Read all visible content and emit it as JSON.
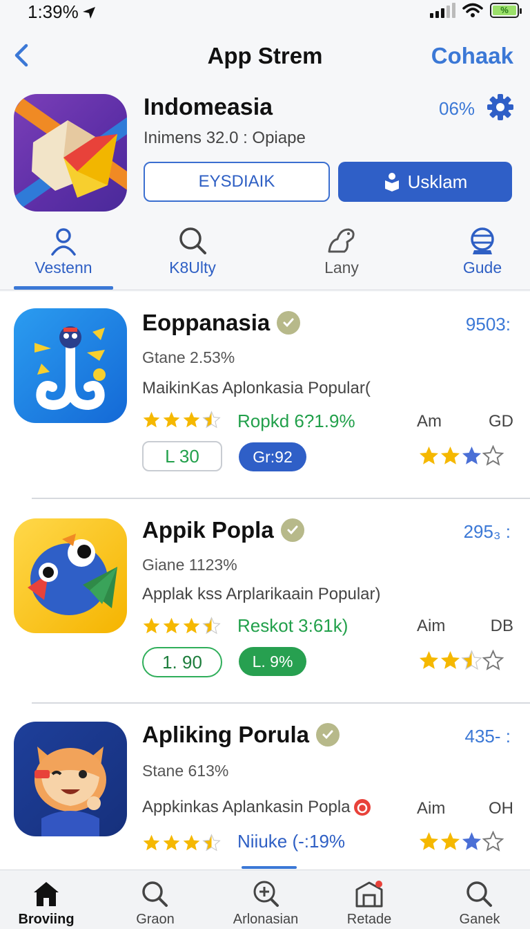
{
  "status_bar": {
    "time": "1:39%"
  },
  "nav": {
    "title": "App Strem",
    "action": "Cohaak"
  },
  "header_app": {
    "name": "Indomeasia",
    "subtitle": "Inimens 32.0 : Opiape",
    "percent": "06%",
    "outline_button": "EYSDIAIK",
    "solid_button": "Usklam"
  },
  "tabs": [
    {
      "label": "Vestenn",
      "icon": "person-icon"
    },
    {
      "label": "K8Ulty",
      "icon": "search-icon"
    },
    {
      "label": "Lany",
      "icon": "ghost-icon"
    },
    {
      "label": "Gude",
      "icon": "globe-icon"
    }
  ],
  "apps": [
    {
      "name": "Eoppanasia",
      "rank": "9503:",
      "sub": "Gtane  2.53%",
      "desc": "MaikinKas Aplonkasia Popular(",
      "stat": "Ropkd 6?1.9%",
      "meta_left": "Am",
      "meta_right": "GD",
      "pill_outline": "L 30",
      "pill_solid": "Gr:92",
      "rating": 3.5,
      "right_rating": "2 gold, 1 blue, 1 empty"
    },
    {
      "name": "Appik Popla",
      "rank": "295₃ :",
      "sub": "Giane  1123%",
      "desc": "Applak kss Arplarikaain Popular)",
      "stat": "Reskot 3:61k)",
      "meta_left": "Aim",
      "meta_right": "DB",
      "pill_outline": "1. 90",
      "pill_solid": "L. 9%",
      "rating": 3.5,
      "right_rating": "2.5 gold, 1.5 empty"
    },
    {
      "name": "Apliking Porula",
      "rank": "435- :",
      "sub": "Stane  613%",
      "desc": "Appkinkas Aplankasin Popla",
      "stat": "Niiuke  (-:19%",
      "meta_left": "Aim",
      "meta_right": "OH",
      "rating": 3.5,
      "right_rating": "2 gold, 1 blue, 1 empty"
    }
  ],
  "bottom_tabs": [
    {
      "label": "Broviing",
      "icon": "home-icon"
    },
    {
      "label": "Graon",
      "icon": "search-icon"
    },
    {
      "label": "Arlonasian",
      "icon": "add-search-icon"
    },
    {
      "label": "Retade",
      "icon": "store-icon"
    },
    {
      "label": "Ganek",
      "icon": "search-icon"
    }
  ],
  "colors": {
    "accent": "#3b78d6",
    "primary_button": "#2f5fc7",
    "green": "#27a050",
    "star": "#f5b800"
  }
}
